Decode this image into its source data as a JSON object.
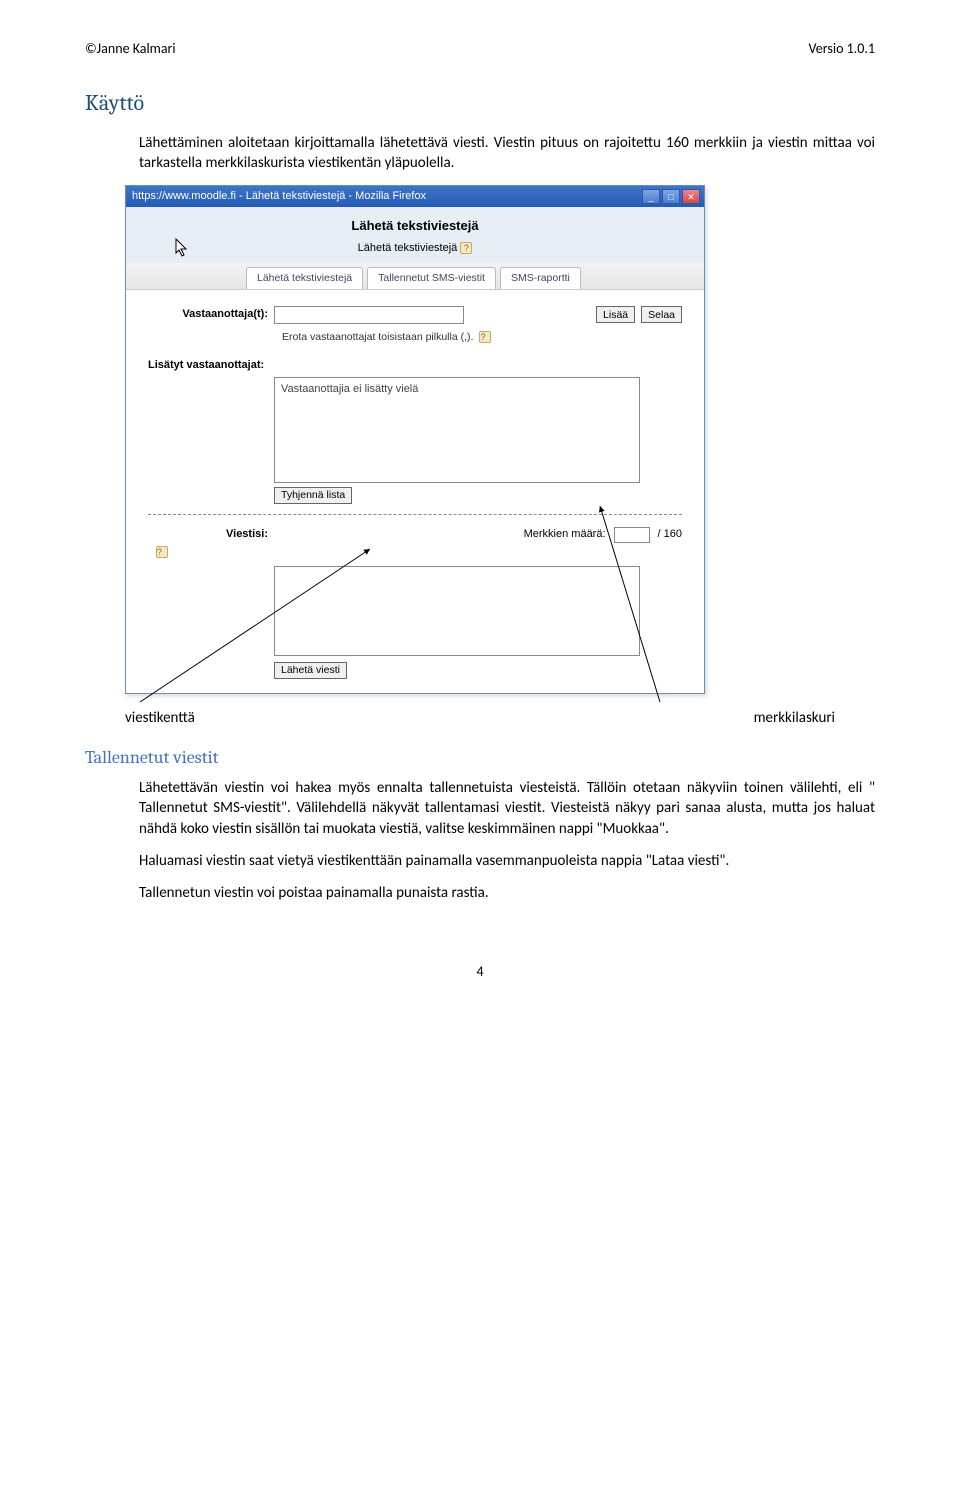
{
  "header": {
    "left": "©Janne Kalmari",
    "right": "Versio 1.0.1"
  },
  "h1": "Käyttö",
  "intro": "Lähettäminen aloitetaan kirjoittamalla lähetettävä viesti. Viestin pituus on rajoitettu 160 merkkiin ja viestin mittaa voi tarkastella merkkilaskurista viestikentän yläpuolella.",
  "screenshot": {
    "title": "https://www.moodle.fi - Lähetä tekstiviestejä - Mozilla Firefox",
    "page_heading": "Lähetä tekstiviestejä",
    "sub_heading": "Lähetä tekstiviestejä",
    "tabs": [
      "Lähetä tekstiviestejä",
      "Tallennetut SMS-viestit",
      "SMS-raportti"
    ],
    "recipients_label": "Vastaanottaja(t):",
    "btn_add": "Lisää",
    "btn_browse": "Selaa",
    "separator_hint": "Erota vastaanottajat toisistaan pilkulla (,).",
    "added_label": "Lisätyt vastaanottajat:",
    "no_recipients": "Vastaanottajia ei lisätty vielä",
    "btn_clear": "Tyhjennä lista",
    "message_label": "Viestisi:",
    "count_label": "Merkkien määrä:",
    "count_max": "/ 160",
    "btn_send": "Lähetä viesti"
  },
  "callouts": {
    "left": "viestikenttä",
    "right": "merkkilaskuri"
  },
  "h2": "Tallennetut viestit",
  "p1": "Lähetettävän viestin voi hakea myös ennalta tallennetuista viesteistä. Tällöin otetaan näkyviin toinen välilehti, eli \" Tallennetut SMS-viestit\". Välilehdellä näkyvät tallentamasi viestit. Viesteistä näkyy pari sanaa alusta, mutta jos haluat nähdä koko viestin sisällön tai muokata viestiä, valitse keskimmäinen nappi \"Muokkaa\".",
  "p2": "Haluamasi viestin saat vietyä viestikenttään painamalla vasemmanpuoleista nappia \"Lataa viesti\".",
  "p3": "Tallennetun viestin voi poistaa painamalla punaista rastia.",
  "page_num": "4"
}
